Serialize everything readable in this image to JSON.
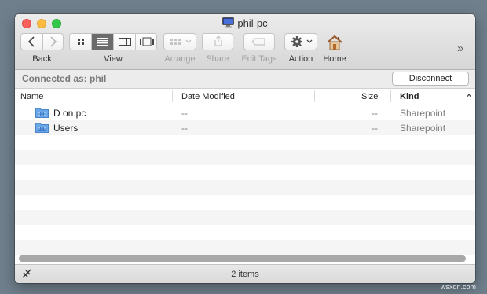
{
  "window": {
    "title": "phil-pc"
  },
  "toolbar": {
    "back_label": "Back",
    "view_label": "View",
    "arrange_label": "Arrange",
    "share_label": "Share",
    "edit_tags_label": "Edit Tags",
    "action_label": "Action",
    "home_label": "Home",
    "overflow_glyph": "»"
  },
  "connection": {
    "text": "Connected as: phil",
    "disconnect_label": "Disconnect"
  },
  "columns": {
    "name": "Name",
    "date_modified": "Date Modified",
    "size": "Size",
    "kind": "Kind"
  },
  "rows": [
    {
      "name": "D on pc",
      "date_modified": "--",
      "size": "--",
      "kind": "Sharepoint"
    },
    {
      "name": "Users",
      "date_modified": "--",
      "size": "--",
      "kind": "Sharepoint"
    }
  ],
  "status": {
    "text": "2 items"
  },
  "watermark": "wsxdn.com"
}
